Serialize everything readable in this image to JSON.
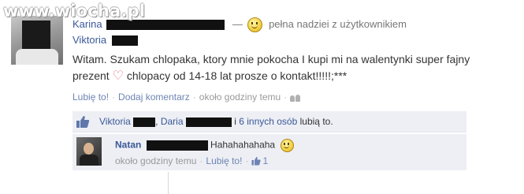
{
  "watermark": "www.wiocha.pl",
  "post": {
    "author_partial": "Karina",
    "feeling_dash": "—",
    "feeling_text": "pełna nadziei z użytkownikiem",
    "tagged": "Viktoria",
    "text_before_heart": "Witam. Szukam chlopaka, ktory mnie pokocha I kupi mi na walentynki super fajny prezent",
    "heart_icon": "heart-icon",
    "text_after_heart": "chlopacy od 14-18 lat prosze o kontakt!!!!!;***",
    "actions": {
      "like": "Lubię to!",
      "comment": "Dodaj komentarz",
      "time": "około godziny temu"
    }
  },
  "likes": {
    "name1": "Viktoria",
    "comma": ",",
    "name2": "Daria",
    "conj": "i",
    "others": "6 innych osób",
    "suffix": "lubią to."
  },
  "comment": {
    "author": "Natan",
    "text": "Hahahahahaha",
    "time": "około godziny temu",
    "like": "Lubię to!",
    "like_count": "1"
  },
  "colors": {
    "link": "#3b5998",
    "meta": "#999999",
    "box_bg": "#edeff4",
    "heart": "#e2747a"
  }
}
